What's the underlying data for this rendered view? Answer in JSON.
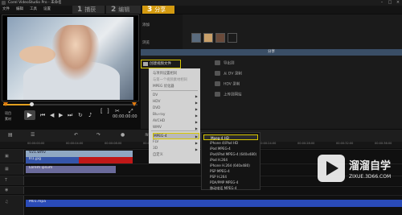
{
  "window": {
    "title": "Corel VideoStudio Pro - 未命名",
    "minimize": "–",
    "maximize": "□",
    "close": "×"
  },
  "menu": [
    "文件",
    "编辑",
    "工具",
    "设置"
  ],
  "stages": [
    {
      "num": "1",
      "label": "捕获"
    },
    {
      "num": "2",
      "label": "编辑"
    },
    {
      "num": "3",
      "label": "分享"
    }
  ],
  "player": {
    "timecode": "00:00:00:00",
    "mode_project": "项目",
    "mode_clip": "素材",
    "controls": {
      "play": "▶",
      "start": "⏮",
      "prev": "◀",
      "next": "▶",
      "end": "⏭",
      "repeat": "↻",
      "volume": "♪",
      "mark_in": "[",
      "mark_out": "]",
      "cut": "✂",
      "enlarge": "⤢"
    },
    "progress": 0.2
  },
  "library": {
    "add_label": "添加",
    "browse_label": "浏览",
    "share_header": "分享",
    "create_file": "创建视频文件"
  },
  "share_items": [
    "导出到",
    "从 DV 录制",
    "HDV 录制",
    "上传到网站"
  ],
  "dropdown": {
    "items": [
      "与项目设置相同",
      "与第一个视频素材相同",
      "MPEG 优化器",
      "DV",
      "HDV",
      "DVD",
      "Blu-ray",
      "AVCHD",
      "WMV",
      "MPEG-4",
      "FLV",
      "3D",
      "自定义"
    ],
    "disabled": [
      1
    ],
    "highlighted": 9,
    "has_submenu": [
      3,
      4,
      5,
      6,
      7,
      8,
      9,
      10,
      11
    ]
  },
  "submenu": [
    "Mpeg-4 HD",
    "iPhone 4/iPad HD",
    "iPod MPEG-4",
    "iPod/iPad MPEG-4 (640x480)",
    "iPod H.264",
    "iPhone H.264 (640x480)",
    "PSP MPEG-4",
    "PSP H.264",
    "PDA/PMP MPEG-4",
    "移动电话 MPEG-4"
  ],
  "timeline": {
    "tracks": [
      {
        "name": "video",
        "clips": [
          "V21.wmv",
          "lll1.jpg"
        ]
      },
      {
        "name": "overlay",
        "clips": [
          "Lorem ipsum"
        ]
      },
      {
        "name": "title",
        "clips": []
      },
      {
        "name": "music",
        "clips": [
          "M01.mpa"
        ]
      }
    ],
    "ruler": [
      "00:00:00:00",
      "00:00:04:00",
      "00:00:08:00",
      "00:00:12:00",
      "00:00:16:00",
      "00:00:20:00",
      "00:00:24:00",
      "00:00:28:00",
      "00:00:32:00",
      "00:00:36:00"
    ]
  },
  "watermark": {
    "brand": "溜溜自学",
    "url": "ZIXUE.3D66.COM"
  },
  "colors": {
    "accent": "#d39a10",
    "highlight": "#d8c600",
    "share_header": "#3a4e66"
  }
}
